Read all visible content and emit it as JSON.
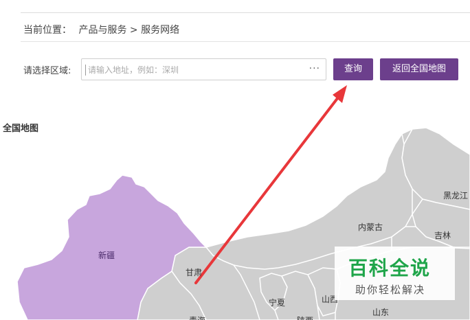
{
  "breadcrumb": {
    "label": "当前位置：",
    "path": "产品与服务 > 服务网络"
  },
  "search": {
    "label": "请选择区域:",
    "placeholder": "请输入地址，例如：深圳",
    "more": "···",
    "query_button": "查询",
    "back_button": "返回全国地图"
  },
  "map": {
    "title": "全国地图",
    "provinces": {
      "xinjiang": "新疆",
      "neimenggu": "内蒙古",
      "heilongjiang": "黑龙江",
      "jilin": "吉林",
      "gansu": "甘肃",
      "ningxia": "宁夏",
      "shanxi": "山西",
      "shandong": "山东",
      "shaanxi": "陕西",
      "qinghai": "青海"
    },
    "colors": {
      "highlight": "#c8a6dd",
      "default": "#cfcfcf",
      "border": "#ffffff",
      "arrow": "#e8373a",
      "accent": "#6c3f8c"
    }
  },
  "watermark": {
    "title": "百科全说",
    "subtitle": "助你轻松解决"
  }
}
